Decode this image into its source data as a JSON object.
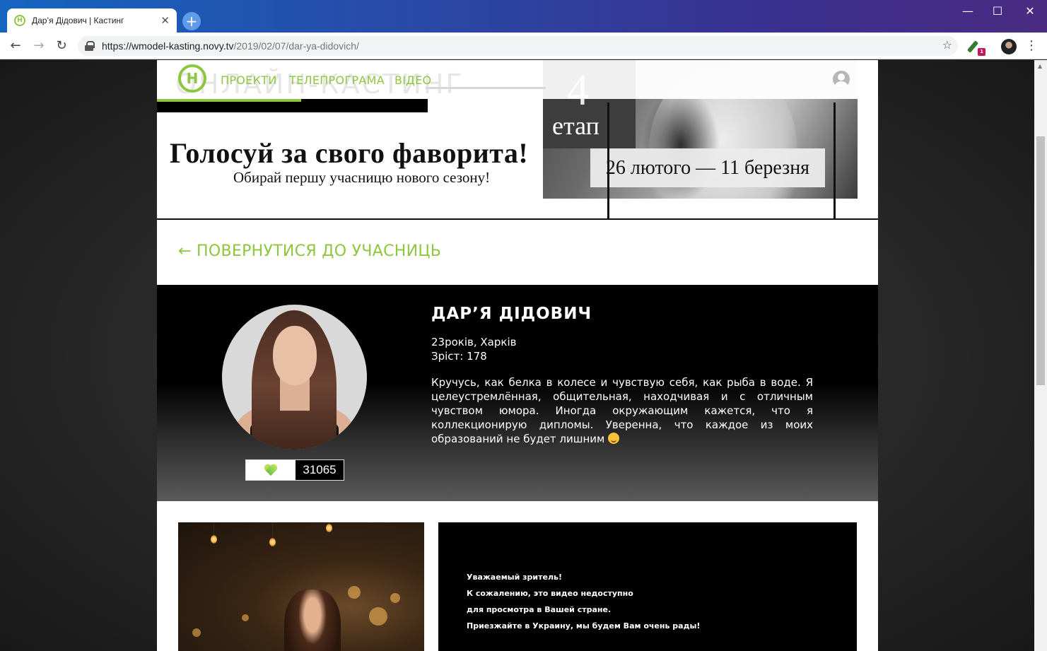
{
  "browser": {
    "tab_title": "Дар’я Дідович | Кастинг",
    "tab_favicon_letter": "Н",
    "url_host": "https://wmodel-kasting.novy.tv",
    "url_path": "/2019/02/07/dar-ya-didovich/",
    "controls": {
      "minimize": "—",
      "maximize": "☐",
      "close": "✕"
    },
    "extension_badge": "1"
  },
  "header": {
    "logo_letter": "Н",
    "nav": [
      "ПРОЕКТИ",
      "ТЕЛЕПРОГРАМА",
      "ВІДЕО"
    ],
    "ghost_text": "ОНЛАЙН-КАСТИНГ"
  },
  "banner": {
    "title": "Голосуй за свого фаворита!",
    "subtitle": "Обирай першу учасницю нового сезону!",
    "stage_number": "4",
    "stage_word": "етап",
    "dates": "26 лютого — 11 березня"
  },
  "back_link": "← ПОВЕРНУТИСЯ ДО УЧАСНИЦЬ",
  "participant": {
    "name": "ДАР’Я ДІДОВИЧ",
    "age_city": "23років, Харків",
    "height": "Зріст: 178",
    "bio": "Кручусь, как белка в колесе и чувствую себя, как рыба в воде. Я целеустремлённая, общительная, находчивая и с отличным чувством юмора. Иногда окружающим кажется, что я коллекционирую дипломы. Уверенна, что каждое из моих образований не будет лишним",
    "votes": "31065"
  },
  "video_notice": {
    "line1": "Уважаемый зритель!",
    "line2": "К сожалению, это видео недоступно",
    "line3": "для просмотра в Вашей стране.",
    "line4": "Приезжайте в Украину, мы будем Вам очень рады!"
  },
  "colors": {
    "brand_green": "#8dc63f"
  }
}
